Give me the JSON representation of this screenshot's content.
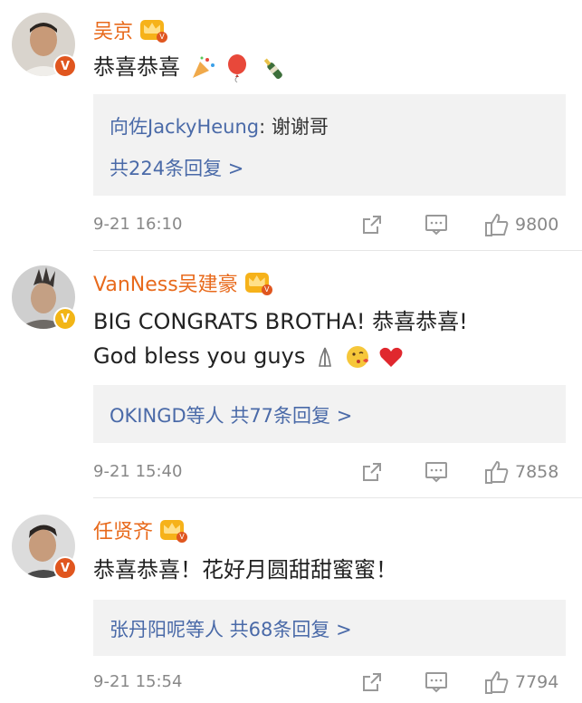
{
  "comments": [
    {
      "name": "吴京",
      "text": "恭喜恭喜",
      "emojis": [
        "party-popper-icon",
        "balloon-icon",
        "champagne-icon"
      ],
      "reply": {
        "author": "向佐JackyHeung",
        "content": ": 谢谢哥",
        "more": "共224条回复 >"
      },
      "time": "9-21 16:10",
      "likes": "9800"
    },
    {
      "name": "VanNess吴建豪",
      "text": "BIG CONGRATS BROTHA! 恭喜恭喜!",
      "text2": "God bless you guys",
      "emojis": [
        "pray-hands-icon",
        "kissing-face-icon",
        "red-heart-icon"
      ],
      "reply": {
        "more": "OKINGD等人 共77条回复 >"
      },
      "time": "9-21 15:40",
      "likes": "7858"
    },
    {
      "name": "任贤齐",
      "text": "恭喜恭喜！花好月圆甜甜蜜蜜！",
      "reply": {
        "more": "张丹阳呢等人 共68条回复 >"
      },
      "time": "9-21 15:54",
      "likes": "7794"
    }
  ],
  "colors": {
    "name": "#e86a1c",
    "reply_link": "#4a6aa8",
    "reply_bg": "#f2f2f2",
    "meta": "#888888",
    "verify_red": "#e0561f",
    "verify_gold": "#f2b516"
  }
}
